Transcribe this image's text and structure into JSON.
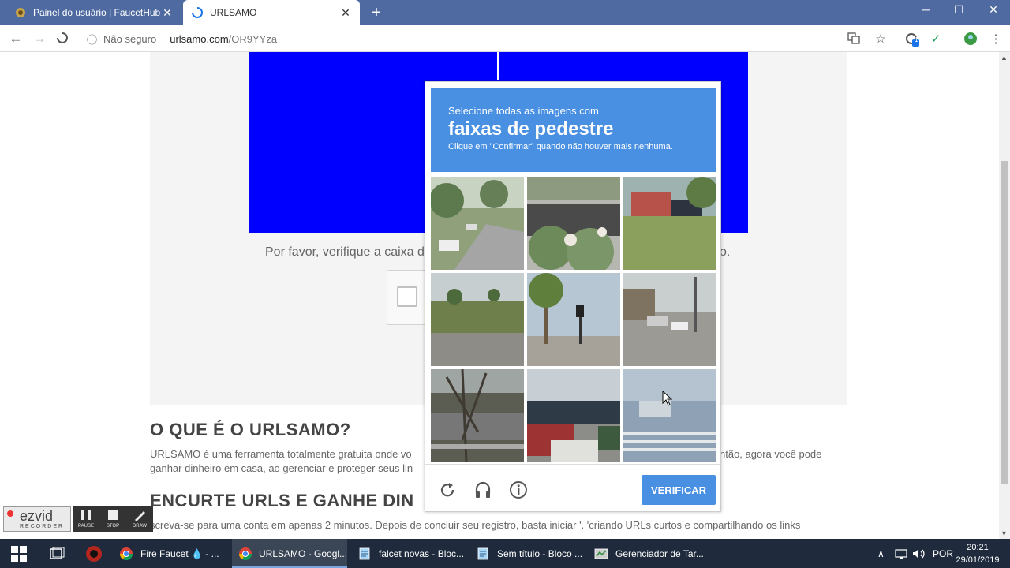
{
  "browser": {
    "tabs": [
      {
        "title": "Painel do usuário | FaucetHub - S",
        "active": false
      },
      {
        "title": "URLSAMO",
        "active": true
      }
    ],
    "new_tab": "+",
    "window_controls": [
      "─",
      "☐",
      "✕"
    ],
    "address": {
      "security": "Não seguro",
      "host": "urlsamo.com",
      "path": "/OR9YYza"
    },
    "extension_badge": "1"
  },
  "page": {
    "verify_text_start": "Por favor, verifique a caixa d",
    "verify_text_end": "o.",
    "section1_title": "O QUE É O URLSAMO?",
    "section1_line1": "URLSAMO é uma ferramenta totalmente gratuita onde vo",
    "section1_line1_end": "ntão, agora você pode",
    "section1_line2": "ganhar dinheiro em casa, ao gerenciar e proteger seus lin",
    "section2_title": "ENCURTE URLS E GANHE DIN",
    "section2_line1": "screva-se para uma conta em apenas 2 minutos. Depois de concluir seu registro, basta iniciar '. 'criando URLs curtos e compartilhando os links"
  },
  "captcha": {
    "instruction": "Selecione todas as imagens com",
    "target": "faixas de pedestre",
    "hint": "Clique em \"Confirmar\" quando não houver mais nenhuma.",
    "verify_button": "VERIFICAR",
    "footer_icons": [
      "refresh-icon",
      "headphones-icon",
      "info-icon"
    ],
    "accent_color": "#4a90e2"
  },
  "ezvid": {
    "logo": "ezvid",
    "subtitle": "RECORDER",
    "buttons": [
      "PAUSE",
      "STOP",
      "DRAW"
    ]
  },
  "taskbar": {
    "items": [
      {
        "label": "Fire Faucet 💧 - ...",
        "active": false
      },
      {
        "label": "URLSAMO - Googl...",
        "active": true
      },
      {
        "label": "falcet novas - Bloc...",
        "active": false
      },
      {
        "label": "Sem título - Bloco ...",
        "active": false
      },
      {
        "label": "Gerenciador de Tar...",
        "active": false
      }
    ],
    "language": "POR",
    "time": "20:21",
    "date": "29/01/2019"
  }
}
